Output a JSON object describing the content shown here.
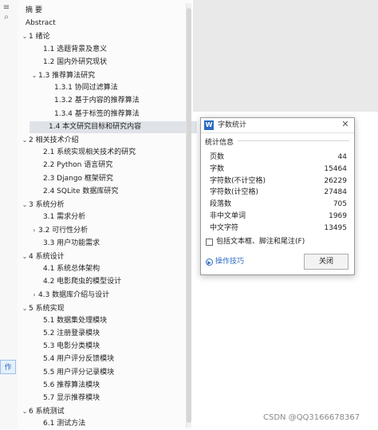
{
  "rail": {
    "task_tag": "作"
  },
  "nav": {
    "items": [
      {
        "text": "摘    要",
        "level": 0
      },
      {
        "text": "Abstract",
        "level": 0
      },
      {
        "text": "1 绪论",
        "level": 0,
        "chevron": "down"
      },
      {
        "text": "1.1 选题背景及意义",
        "level": 1
      },
      {
        "text": "1.2 国内外研究现状",
        "level": 1
      },
      {
        "text": "1.3 推荐算法研究",
        "level": 1,
        "chevron": "down"
      },
      {
        "text": "1.3.1 协同过滤算法",
        "level": 2
      },
      {
        "text": "1.3.2 基于内容的推荐算法",
        "level": 2
      },
      {
        "text": "1.3.4 基于标签的推荐算法",
        "level": 2
      },
      {
        "text": "1.4 本文研究目标和研究内容",
        "level": 1,
        "selected": true
      },
      {
        "text": "2 相关技术介绍",
        "level": 0,
        "chevron": "down"
      },
      {
        "text": "2.1 系统实现相关技术的研究",
        "level": 1
      },
      {
        "text": "2.2 Python 语言研究",
        "level": 1
      },
      {
        "text": "2.3 Django 框架研究",
        "level": 1
      },
      {
        "text": "2.4 SQLite 数据库研究",
        "level": 1
      },
      {
        "text": "3 系统分析",
        "level": 0,
        "chevron": "down"
      },
      {
        "text": "3.1 需求分析",
        "level": 1
      },
      {
        "text": "3.2 可行性分析",
        "level": 1,
        "chevron": "right"
      },
      {
        "text": "3.3 用户功能需求",
        "level": 1
      },
      {
        "text": "4 系统设计",
        "level": 0,
        "chevron": "down"
      },
      {
        "text": "4.1 系统总体架构",
        "level": 1
      },
      {
        "text": "4.2 电影爬虫的模型设计",
        "level": 1
      },
      {
        "text": "4.3 数据库介绍与设计",
        "level": 1,
        "chevron": "right"
      },
      {
        "text": "5 系统实现",
        "level": 0,
        "chevron": "down"
      },
      {
        "text": "5.1 数据集处理模块",
        "level": 1
      },
      {
        "text": "5.2 注册登录模块",
        "level": 1
      },
      {
        "text": "5.3 电影分类模块",
        "level": 1
      },
      {
        "text": "5.4 用户评分反馈模块",
        "level": 1
      },
      {
        "text": "5.5 用户评分记录模块",
        "level": 1
      },
      {
        "text": "5.6 推荐算法模块",
        "level": 1
      },
      {
        "text": "5.7 显示推荐模块",
        "level": 1
      },
      {
        "text": "6 系统测试",
        "level": 0,
        "chevron": "down"
      },
      {
        "text": "6.1 测试方法",
        "level": 1
      }
    ]
  },
  "dialog": {
    "title": "字数统计",
    "app_icon_letter": "W",
    "group_label": "统计信息",
    "stats": [
      {
        "label": "页数",
        "value": "44"
      },
      {
        "label": "字数",
        "value": "15464"
      },
      {
        "label": "字符数(不计空格)",
        "value": "26229"
      },
      {
        "label": "字符数(计空格)",
        "value": "27484"
      },
      {
        "label": "段落数",
        "value": "705"
      },
      {
        "label": "非中文单词",
        "value": "1969"
      },
      {
        "label": "中文字符",
        "value": "13495"
      }
    ],
    "checkbox_label": "包括文本框、脚注和尾注(F)",
    "checkbox_checked": false,
    "tips_link": "操作技巧",
    "close_button": "关闭",
    "accent": "#2b6cc4"
  },
  "watermark": "CSDN @QQ3166678367"
}
